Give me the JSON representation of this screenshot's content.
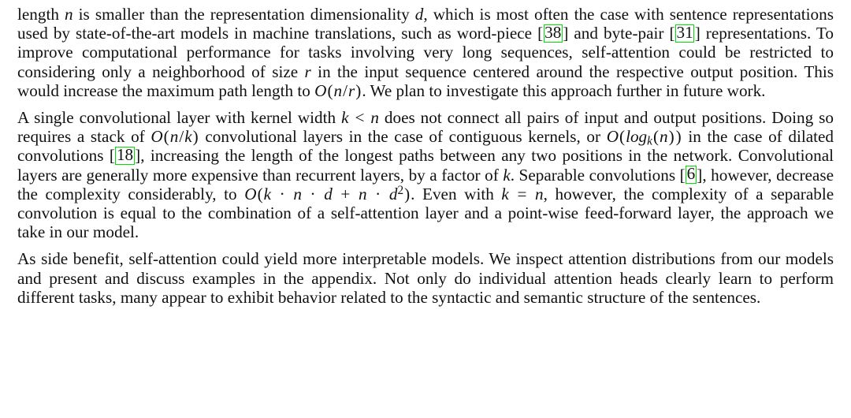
{
  "document": {
    "type": "pdf-paper-body-text",
    "link_box_color": "#00e000",
    "text_color": "#111111",
    "background_color": "#ffffff"
  },
  "paragraphs": [
    {
      "id": "para-1",
      "runs": [
        {
          "kind": "text",
          "value": "length "
        },
        {
          "kind": "math",
          "value": "n"
        },
        {
          "kind": "text",
          "value": " is smaller than the representation dimensionality "
        },
        {
          "kind": "math",
          "value": "d"
        },
        {
          "kind": "text",
          "value": ", which is most often the case with sentence representations used by state-of-the-art models in machine translations, such as word-piece "
        },
        {
          "kind": "cite",
          "value": "38"
        },
        {
          "kind": "text",
          "value": " and byte-pair "
        },
        {
          "kind": "cite",
          "value": "31"
        },
        {
          "kind": "text",
          "value": " representations. To improve computational performance for tasks involving very long sequences, self-attention could be restricted to considering only a neighborhood of size "
        },
        {
          "kind": "math",
          "value": "r"
        },
        {
          "kind": "text",
          "value": " in the input sequence centered around the respective output position. This would increase the maximum path length to "
        },
        {
          "kind": "math",
          "value": "O(n/r)"
        },
        {
          "kind": "text",
          "value": ". We plan to investigate this approach further in future work."
        }
      ]
    },
    {
      "id": "para-2",
      "runs": [
        {
          "kind": "text",
          "value": "A single convolutional layer with kernel width "
        },
        {
          "kind": "math",
          "value": "k < n"
        },
        {
          "kind": "text",
          "value": " does not connect all pairs of input and output positions. Doing so requires a stack of "
        },
        {
          "kind": "math",
          "value": "O(n/k)"
        },
        {
          "kind": "text",
          "value": " convolutional layers in the case of contiguous kernels, or "
        },
        {
          "kind": "math",
          "value": "O(log_k(n))"
        },
        {
          "kind": "text",
          "value": " in the case of dilated convolutions "
        },
        {
          "kind": "cite",
          "value": "18"
        },
        {
          "kind": "text",
          "value": ", increasing the length of the longest paths between any two positions in the network. Convolutional layers are generally more expensive than recurrent layers, by a factor of "
        },
        {
          "kind": "math",
          "value": "k"
        },
        {
          "kind": "text",
          "value": ". Separable convolutions "
        },
        {
          "kind": "cite",
          "value": "6"
        },
        {
          "kind": "text",
          "value": ", however, decrease the complexity considerably, to "
        },
        {
          "kind": "math",
          "value": "O(k · n · d + n · d^2)"
        },
        {
          "kind": "text",
          "value": ". Even with "
        },
        {
          "kind": "math",
          "value": "k = n"
        },
        {
          "kind": "text",
          "value": ", however, the complexity of a separable convolution is equal to the combination of a self-attention layer and a point-wise feed-forward layer, the approach we take in our model."
        }
      ]
    },
    {
      "id": "para-3",
      "runs": [
        {
          "kind": "text",
          "value": "As side benefit, self-attention could yield more interpretable models. We inspect attention distributions from our models and present and discuss examples in the appendix. Not only do individual attention heads clearly learn to perform different tasks, many appear to exhibit behavior related to the syntactic and semantic structure of the sentences."
        }
      ]
    }
  ],
  "citations": [
    {
      "label": "38",
      "paragraph": "para-1"
    },
    {
      "label": "31",
      "paragraph": "para-1"
    },
    {
      "label": "18",
      "paragraph": "para-2"
    },
    {
      "label": "6",
      "paragraph": "para-2"
    }
  ]
}
